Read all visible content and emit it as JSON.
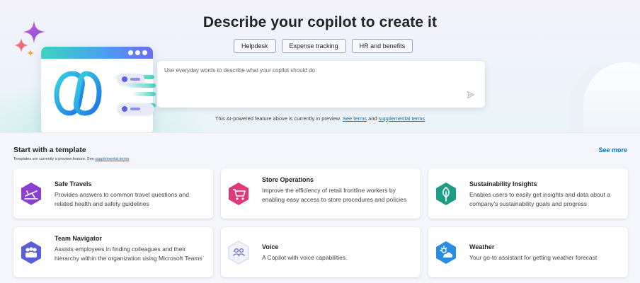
{
  "hero": {
    "title": "Describe your copilot to create it",
    "chips": [
      "Helpdesk",
      "Expense tracking",
      "HR and benefits"
    ],
    "prompt_placeholder": "Use everyday words to describe what your copilot should do",
    "preview_note_prefix": "This AI-powered feature above is currently in preview.",
    "see_terms_link": "See terms",
    "and_text": "and",
    "supplemental_terms_link": "supplemental terms"
  },
  "templates": {
    "heading": "Start with a template",
    "subtext_prefix": "Templates are currently a preview feature. See",
    "subtext_link": "supplemental terms",
    "see_more": "See more",
    "cards": [
      {
        "title": "Safe Travels",
        "description": "Provides answers to common travel questions and related health and safety guidelines",
        "icon": "airplane-icon",
        "color": "#8a3fd1"
      },
      {
        "title": "Store Operations",
        "description": "Improve the efficiency of retail frontline workers by enabling easy access to store procedures and policies",
        "icon": "shopping-cart-icon",
        "color": "#e0397a"
      },
      {
        "title": "Sustainability Insights",
        "description": "Enables users to easily get insights and data about a company's sustainability goals and progress",
        "icon": "leaf-icon",
        "color": "#1f9c84"
      },
      {
        "title": "Team Navigator",
        "description": "Assists employees in finding colleagues and their hierarchy within the organization using Microsoft Teams",
        "icon": "people-icon",
        "color": "#5b5fd6"
      },
      {
        "title": "Voice",
        "description": "A Copilot with voice capabilities.",
        "icon": "voice-people-icon",
        "color": "#6b6fd6"
      },
      {
        "title": "Weather",
        "description": "Your go-to assistant for getting weather forecast",
        "icon": "weather-icon",
        "color": "#2a8de0"
      }
    ]
  }
}
